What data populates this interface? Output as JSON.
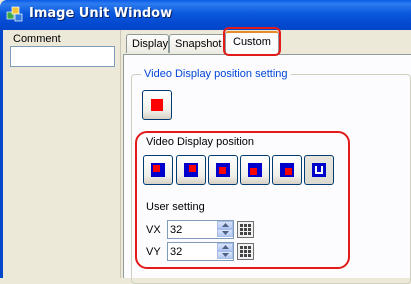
{
  "window": {
    "title": "Image Unit Window",
    "icon": "app-icon"
  },
  "comment": {
    "label": "Comment",
    "value": ""
  },
  "tabs": [
    {
      "label": "Display",
      "active": false
    },
    {
      "label": "Snapshot",
      "active": false
    },
    {
      "label": "Custom",
      "active": true
    }
  ],
  "group": {
    "title": "Video Display position setting",
    "video_display_position_label": "Video Display position",
    "position_buttons": [
      {
        "icon": "top-left-position-icon"
      },
      {
        "icon": "top-right-position-icon"
      },
      {
        "icon": "center-position-icon"
      },
      {
        "icon": "bottom-left-position-icon"
      },
      {
        "icon": "bottom-right-position-icon"
      },
      {
        "icon": "user-position-icon",
        "selected": true
      }
    ],
    "user_setting_label": "User setting",
    "vx": {
      "label": "VX",
      "value": "32"
    },
    "vy": {
      "label": "VY",
      "value": "32"
    }
  },
  "colors": {
    "title_bar": "#0a58dd",
    "group_title": "#0046d5",
    "highlight": "#e21a1a",
    "position_square": "#0000cc",
    "position_dot": "#ff0000"
  }
}
